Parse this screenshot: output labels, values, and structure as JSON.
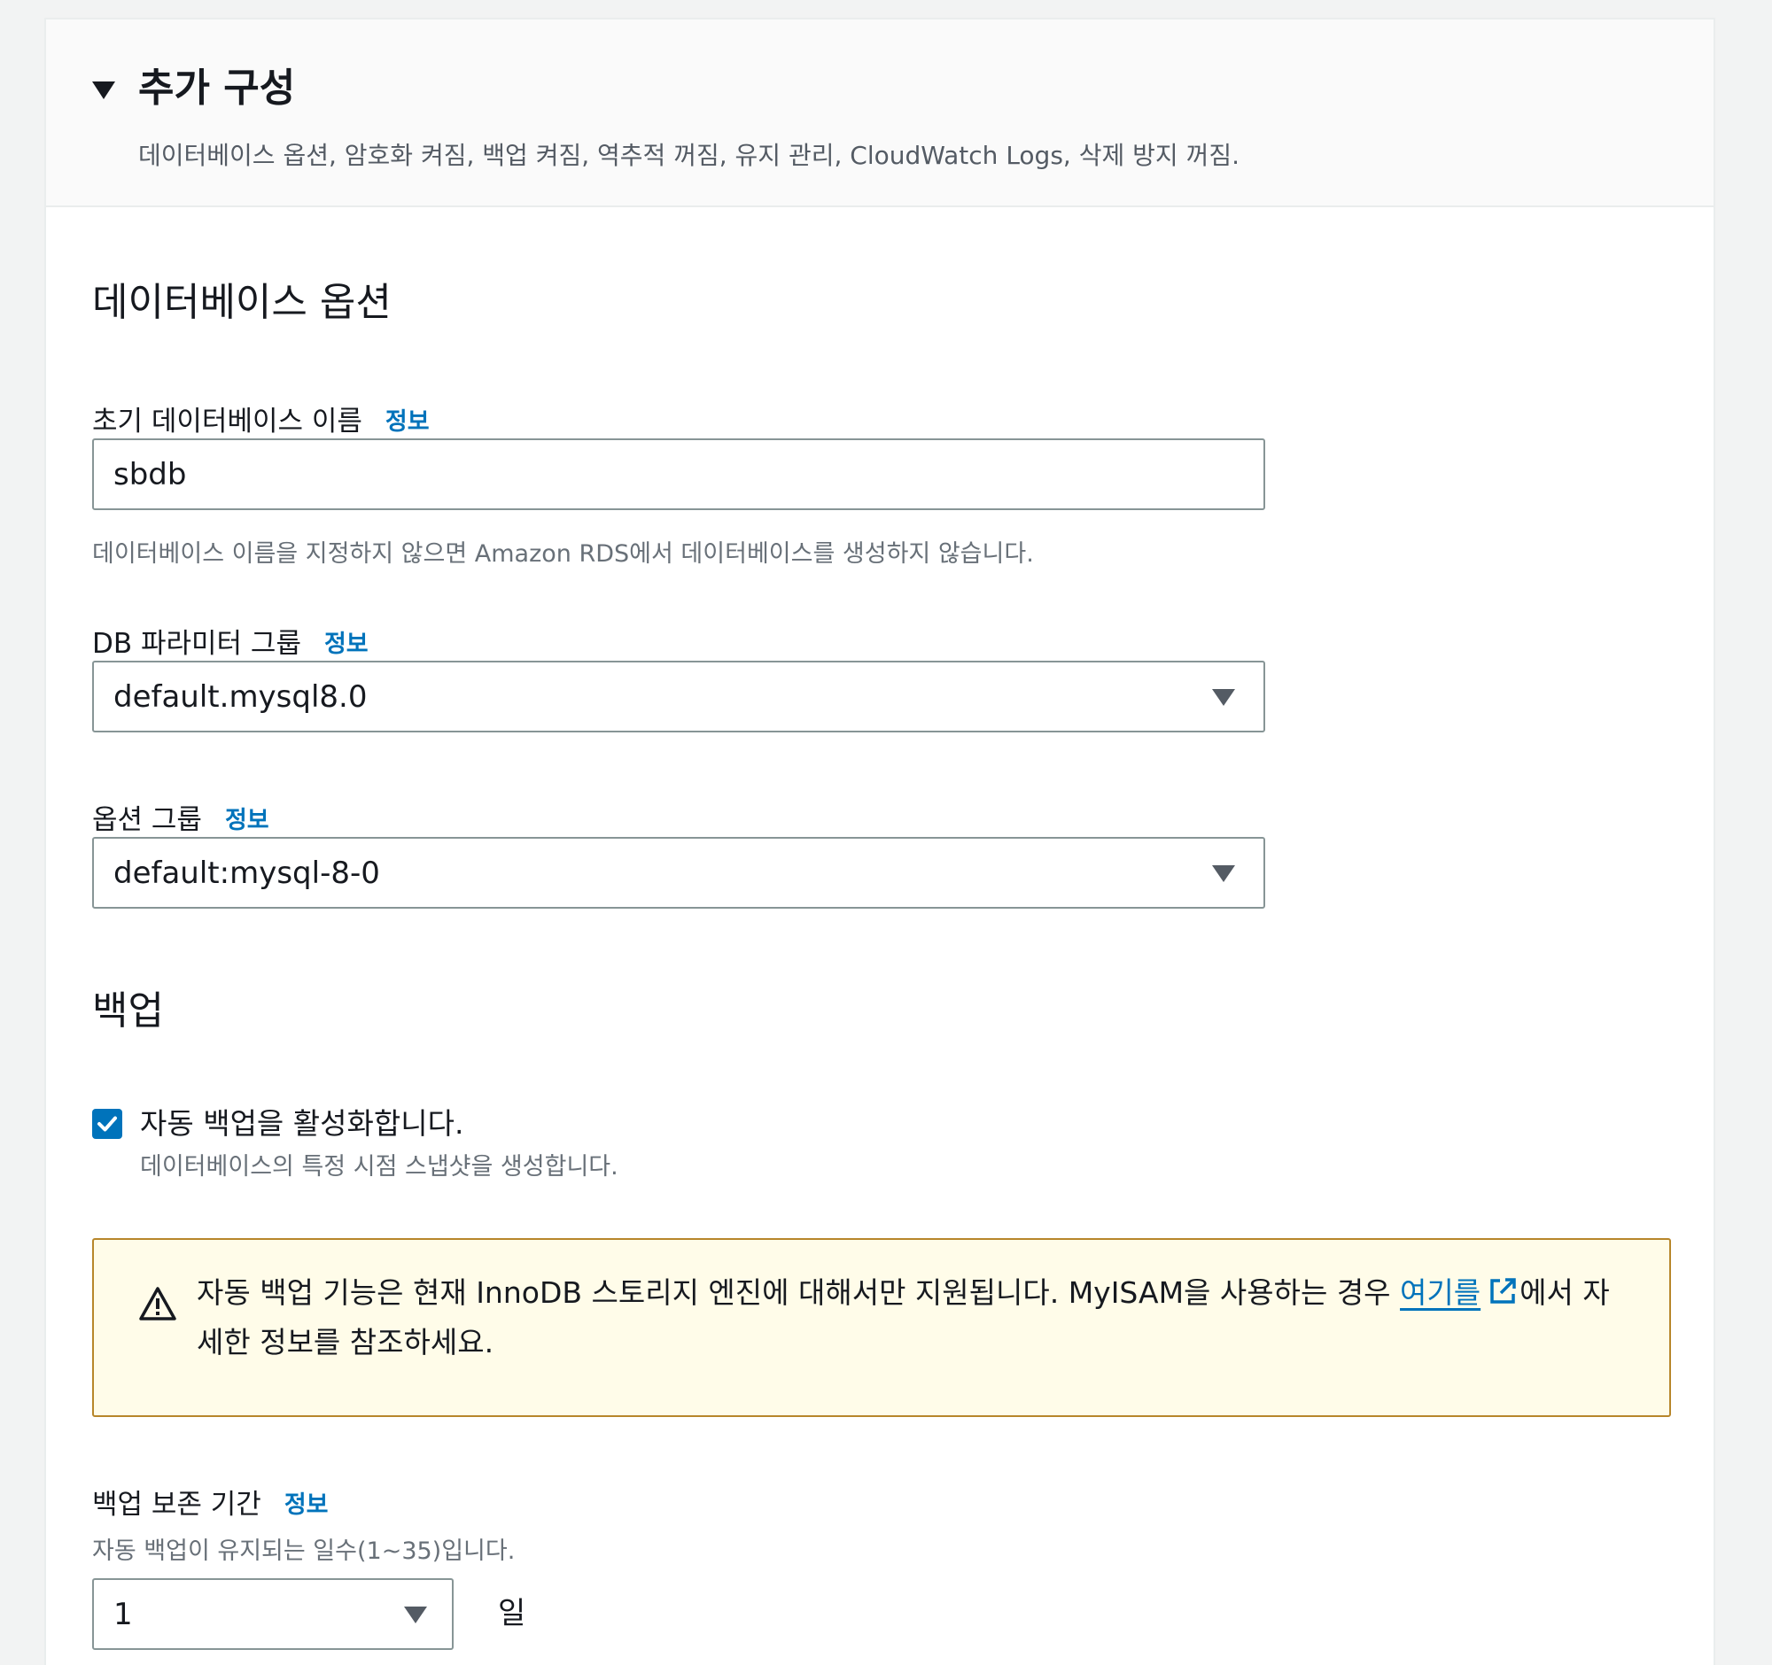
{
  "header": {
    "title": "추가 구성",
    "description": "데이터베이스 옵션, 암호화 켜짐, 백업 켜짐, 역추적 꺼짐, 유지 관리, CloudWatch Logs, 삭제 방지 꺼짐."
  },
  "db_options": {
    "section_title": "데이터베이스 옵션",
    "initial_db_name": {
      "label": "초기 데이터베이스 이름",
      "info": "정보",
      "value": "sbdb",
      "hint": "데이터베이스 이름을 지정하지 않으면 Amazon RDS에서 데이터베이스를 생성하지 않습니다."
    },
    "param_group": {
      "label": "DB 파라미터 그룹",
      "info": "정보",
      "value": "default.mysql8.0"
    },
    "option_group": {
      "label": "옵션 그룹",
      "info": "정보",
      "value": "default:mysql-8-0"
    }
  },
  "backup": {
    "section_title": "백업",
    "auto_backup": {
      "checked": true,
      "label": "자동 백업을 활성화합니다.",
      "hint": "데이터베이스의 특정 시점 스냅샷을 생성합니다."
    },
    "alert": {
      "text_before": "자동 백업 기능은 현재 InnoDB 스토리지 엔진에 대해서만 지원됩니다. MyISAM을 사용하는 경우 ",
      "link_text": "여기를",
      "text_after": "에서 자세한 정보를 참조하세요."
    },
    "retention": {
      "label": "백업 보존 기간",
      "info": "정보",
      "hint": "자동 백업이 유지되는 일수(1~35)입니다.",
      "value": "1",
      "unit": "일"
    }
  },
  "colors": {
    "link": "#0073bb",
    "alert_bg": "#fffce9",
    "alert_border": "#b7862a",
    "checkbox": "#0073bb"
  }
}
